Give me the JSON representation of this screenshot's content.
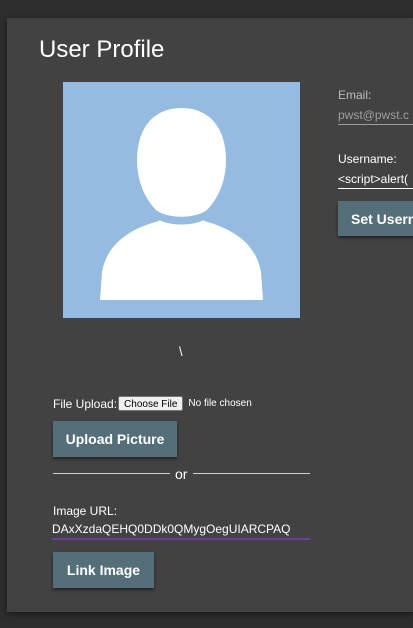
{
  "page": {
    "title": "User Profile"
  },
  "avatar": {
    "icon": "user-silhouette-icon",
    "caption": "\\"
  },
  "upload": {
    "file_label": "File Upload:",
    "choose_file_label": "Choose File",
    "no_file_text": "No file chosen",
    "upload_button_label": "Upload Picture",
    "divider_text": "or",
    "url_label": "Image URL:",
    "url_value": "DAxXzdaQEHQ0DDk0QMygOegUIARCPAQ",
    "link_button_label": "Link Image"
  },
  "account": {
    "email_label": "Email:",
    "email_value": "pwst@pwst.c",
    "username_label": "Username:",
    "username_value": "<script>alert(",
    "set_username_label": "Set Userna"
  },
  "colors": {
    "card_bg": "#424242",
    "page_bg": "#2e2e2e",
    "avatar_bg": "#95bbe0",
    "button_bg": "#546e7a",
    "url_underline": "#6b3fa0"
  }
}
